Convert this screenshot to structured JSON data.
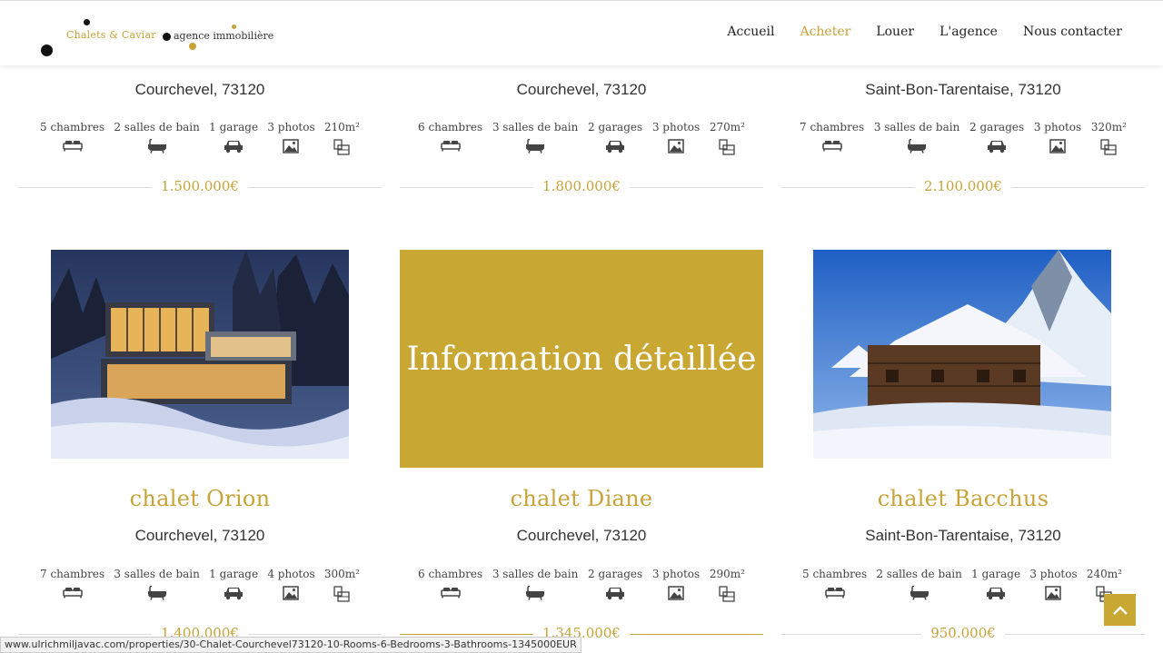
{
  "header": {
    "logo": {
      "brand": "Chalets & Caviar",
      "tagline": "agence immobilière"
    },
    "nav": [
      {
        "label": "Accueil",
        "active": false
      },
      {
        "label": "Acheter",
        "active": true
      },
      {
        "label": "Louer",
        "active": false
      },
      {
        "label": "L'agence",
        "active": false
      },
      {
        "label": "Nous contacter",
        "active": false
      }
    ]
  },
  "top_row": [
    {
      "location": "Courchevel, 73120",
      "features": [
        "5 chambres",
        "2 salles de bain",
        "1 garage",
        "3 photos",
        "210m²"
      ],
      "price": "1.500.000€"
    },
    {
      "location": "Courchevel, 73120",
      "features": [
        "6 chambres",
        "3 salles de bain",
        "2 garages",
        "3 photos",
        "270m²"
      ],
      "price": "1.800.000€"
    },
    {
      "location": "Saint-Bon-Tarentaise, 73120",
      "features": [
        "7 chambres",
        "3 salles de bain",
        "2 garages",
        "3 photos",
        "320m²"
      ],
      "price": "2.100.000€"
    }
  ],
  "bottom_row": [
    {
      "title": "chalet Orion",
      "location": "Courchevel, 73120",
      "features": [
        "7 chambres",
        "3 salles de bain",
        "1 garage",
        "4 photos",
        "300m²"
      ],
      "price": "1.400.000€"
    },
    {
      "title": "chalet Diane",
      "location": "Courchevel, 73120",
      "features": [
        "6 chambres",
        "3 salles de bain",
        "2 garages",
        "3 photos",
        "290m²"
      ],
      "price": "1.345.000€"
    },
    {
      "title": "chalet Bacchus",
      "location": "Saint-Bon-Tarentaise, 73120",
      "features": [
        "5 chambres",
        "2 salles de bain",
        "1 garage",
        "3 photos",
        "240m²"
      ],
      "price": "950.000€"
    }
  ],
  "hover_overlay": {
    "text": "Information détaillée"
  },
  "status_bar": {
    "url": "www.ulrichmiljavac.com/properties/30-Chalet-Courchevel73120-10-Rooms-6-Bedrooms-3-Bathrooms-1345000EUR"
  },
  "colors": {
    "accent": "#c7a33a",
    "overlay": "#c9a733"
  },
  "icons": [
    "bed-icon",
    "bathtub-icon",
    "car-icon",
    "photo-icon",
    "floorplan-icon",
    "arrow-up-icon"
  ]
}
